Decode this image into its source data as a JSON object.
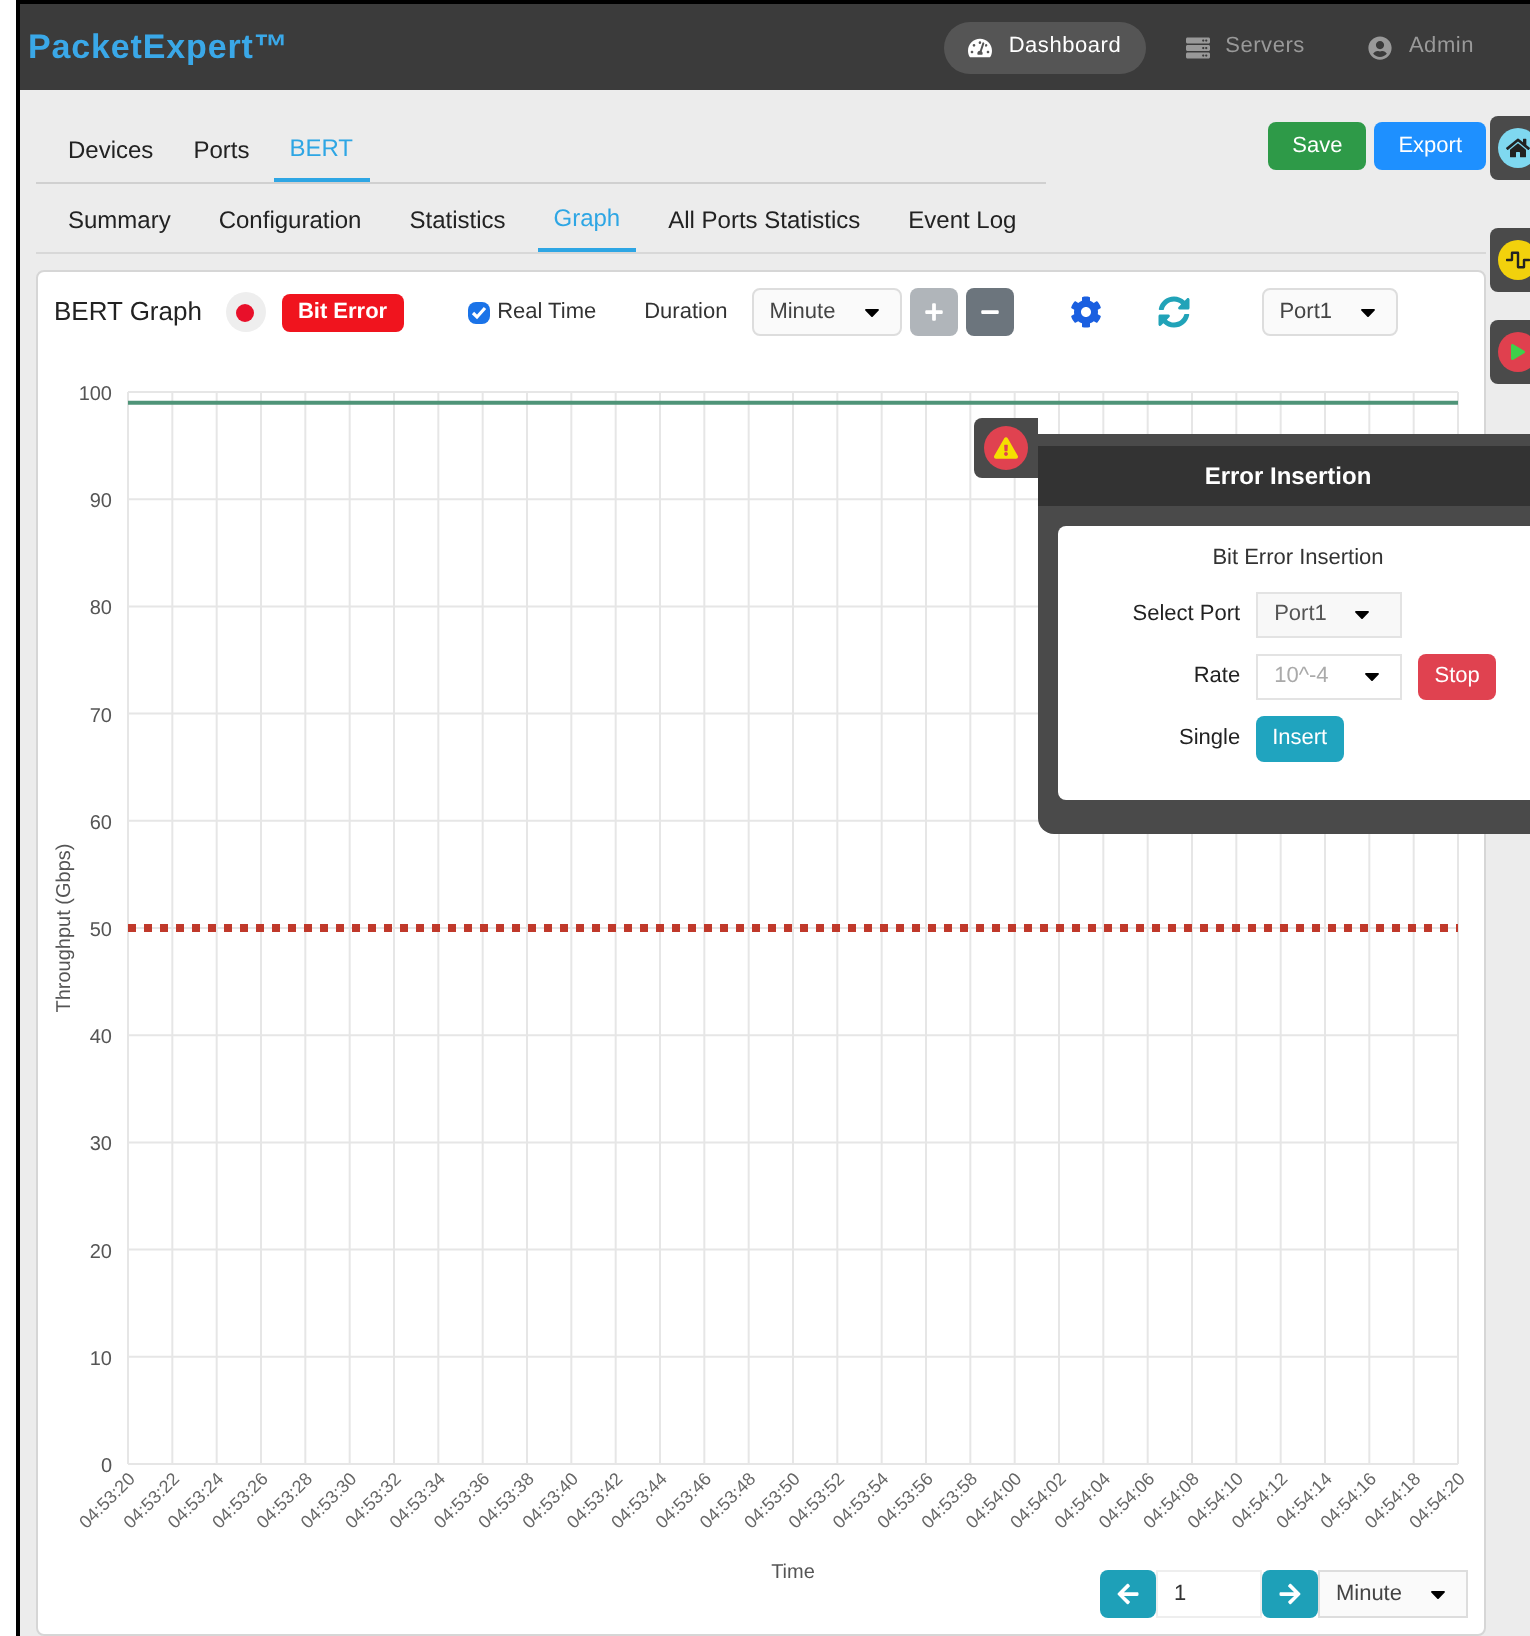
{
  "app": {
    "logo": "PacketExpert™",
    "nav": [
      {
        "label": "Dashboard",
        "kind": "gauge",
        "selected": true
      },
      {
        "label": "Servers",
        "kind": "server",
        "selected": false
      },
      {
        "label": "Admin",
        "kind": "user",
        "selected": false
      }
    ]
  },
  "tabs": [
    {
      "label": "Devices",
      "selected": false
    },
    {
      "label": "Ports",
      "selected": false
    },
    {
      "label": "BERT",
      "selected": true
    }
  ],
  "actions": [
    {
      "label": "Save",
      "kind": "save"
    },
    {
      "label": "Export",
      "kind": "export"
    }
  ],
  "subtabs": [
    {
      "label": "Summary",
      "selected": false
    },
    {
      "label": "Configuration",
      "selected": false
    },
    {
      "label": "Statistics",
      "selected": false
    },
    {
      "label": "Graph",
      "selected": true
    },
    {
      "label": "All Ports Statistics",
      "selected": false
    },
    {
      "label": "Event Log",
      "selected": false
    }
  ],
  "graph": {
    "title": "BERT Graph",
    "bit_error_button": "Bit Error",
    "real_time": {
      "label": "Real Time",
      "checked": true
    },
    "duration_label": "Duration",
    "duration": "Minute",
    "port": "Port1",
    "chart_data": {
      "type": "line",
      "grid": true,
      "xlabel": "Time",
      "ylabel": "Throughput (Gbps)",
      "categories": [
        "04:53:20",
        "04:53:22",
        "04:53:24",
        "04:53:26",
        "04:53:28",
        "04:53:30",
        "04:53:32",
        "04:53:34",
        "04:53:36",
        "04:53:38",
        "04:53:40",
        "04:53:42",
        "04:53:44",
        "04:53:46",
        "04:53:48",
        "04:53:50",
        "04:53:52",
        "04:53:54",
        "04:53:56",
        "04:53:58",
        "04:54:00",
        "04:54:02",
        "04:54:04",
        "04:54:06",
        "04:54:08",
        "04:54:10",
        "04:54:12",
        "04:54:14",
        "04:54:16",
        "04:54:18",
        "04:54:20"
      ],
      "series": [
        {
          "color": "#4f9478",
          "line_style": "solid",
          "values": [
            99,
            99,
            99,
            99,
            99,
            99,
            99,
            99,
            99,
            99,
            99,
            99,
            99,
            99,
            99,
            99,
            99,
            99,
            99,
            99,
            99,
            99,
            99,
            99,
            99,
            99,
            99,
            99,
            99,
            99,
            99
          ]
        },
        {
          "color": "#c0392b",
          "line_style": "dotted",
          "values": [
            50,
            50,
            50,
            50,
            50,
            50,
            50,
            50,
            50,
            50,
            50,
            50,
            50,
            50,
            50,
            50,
            50,
            50,
            50,
            50,
            50,
            50,
            50,
            50,
            50,
            50,
            50,
            50,
            50,
            50,
            50
          ]
        }
      ],
      "ylim": [
        0,
        100
      ],
      "yticks": [
        0,
        10,
        20,
        30,
        40,
        50,
        60,
        70,
        80,
        90,
        100
      ]
    }
  },
  "error_insertion": {
    "title": "Error Insertion",
    "subtitle": "Bit Error Insertion",
    "port_label": "Select Port",
    "port": "Port1",
    "rate_label": "Rate",
    "rate": "10^-4",
    "rate_disabled": true,
    "stop_button": "Stop",
    "single_label": "Single",
    "insert_button": "Insert"
  },
  "pager": {
    "page": "1",
    "unit": "Minute"
  }
}
